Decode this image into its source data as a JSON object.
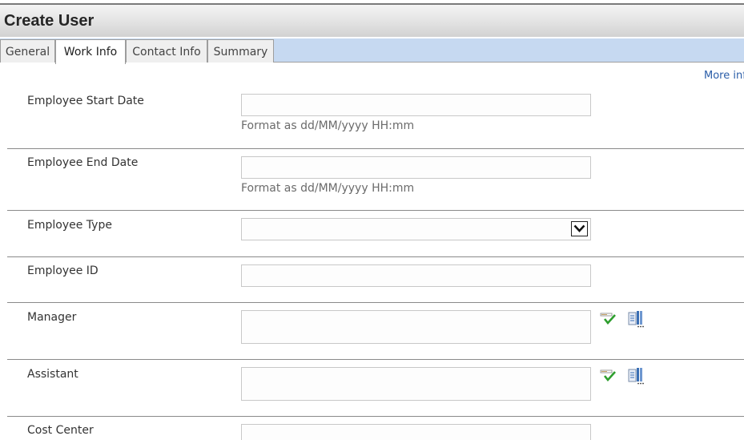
{
  "header": {
    "title": "Create User"
  },
  "tabs": [
    {
      "label": "General"
    },
    {
      "label": "Work Info",
      "active": true
    },
    {
      "label": "Contact Info"
    },
    {
      "label": "Summary"
    }
  ],
  "more_info_link": "More inf",
  "form": {
    "start_date": {
      "label": "Employee Start Date",
      "value": "",
      "hint": "Format as dd/MM/yyyy HH:mm"
    },
    "end_date": {
      "label": "Employee End Date",
      "value": "",
      "hint": "Format as dd/MM/yyyy HH:mm"
    },
    "employee_type": {
      "label": "Employee Type",
      "selected": ""
    },
    "employee_id": {
      "label": "Employee ID",
      "value": ""
    },
    "manager": {
      "label": "Manager",
      "value": ""
    },
    "assistant": {
      "label": "Assistant",
      "value": ""
    },
    "cost_center": {
      "label": "Cost Center",
      "value": ""
    }
  },
  "icons": {
    "check_names": "check-names-icon",
    "browse": "address-book-icon",
    "dropdown": "chevron-down-icon"
  },
  "colors": {
    "tab_strip": "#c6d9f1",
    "link": "#2a5da8",
    "check_green": "#2e9e2e",
    "browse_blue": "#3a6fb5"
  }
}
